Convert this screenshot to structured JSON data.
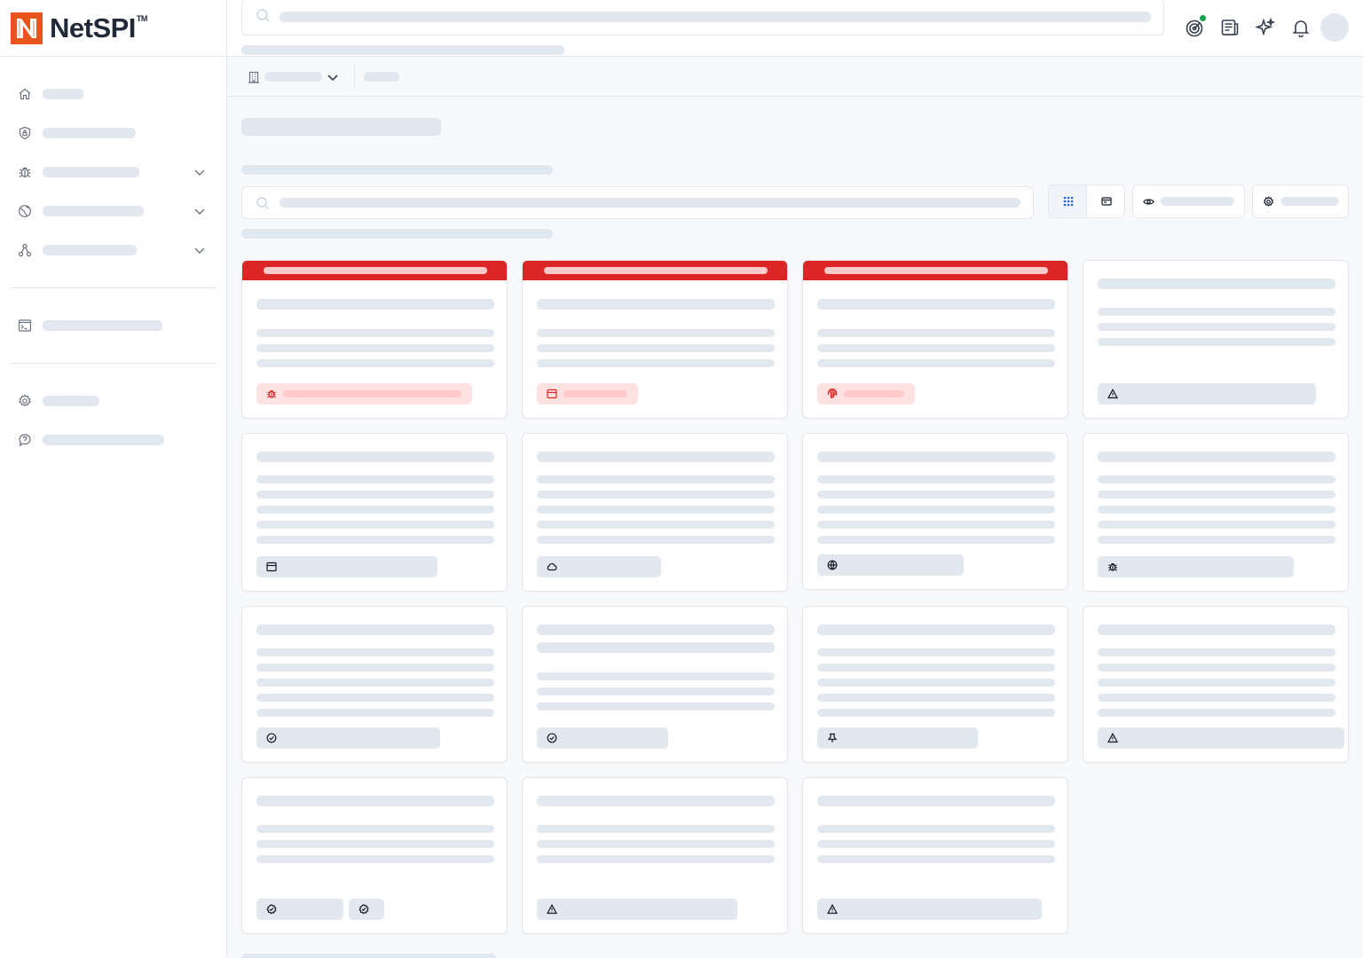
{
  "app": {
    "brand": "NetSPI",
    "trademark": "TM"
  },
  "colors": {
    "accent": "#dc2626",
    "brand_orange": "#e8541b",
    "skeleton": "#e2e8f0",
    "status_dot": "#16a34a",
    "active_view": "#2563eb"
  },
  "sidebar": {
    "items": [
      {
        "icon": "home-icon",
        "expandable": false
      },
      {
        "icon": "shield-icon",
        "expandable": false
      },
      {
        "icon": "bug-icon",
        "expandable": true
      },
      {
        "icon": "globe-icon",
        "expandable": true
      },
      {
        "icon": "network-icon",
        "expandable": true
      },
      {
        "icon": "terminal-icon",
        "expandable": false
      },
      {
        "icon": "gear-icon",
        "expandable": false
      },
      {
        "icon": "support-chat-icon",
        "expandable": false
      }
    ]
  },
  "topbar": {
    "icons": [
      "target-icon",
      "news-icon",
      "sparkle-icon",
      "bell-icon"
    ],
    "target_status": "online"
  },
  "subbar": {
    "icon": "building-icon"
  },
  "toolbar": {
    "view_modes": [
      "grid-view-icon",
      "card-view-icon"
    ],
    "active_view": "grid",
    "buttons": [
      "eye-icon",
      "gear-icon"
    ]
  },
  "cards": [
    {
      "header": true,
      "tag_icon": "bug-icon",
      "tag_style": "critical"
    },
    {
      "header": true,
      "tag_icon": "window-icon",
      "tag_style": "critical"
    },
    {
      "header": true,
      "tag_icon": "fingerprint-icon",
      "tag_style": "critical"
    },
    {
      "header": false,
      "tag_icon": "warning-icon",
      "tag_style": "neutral"
    },
    {
      "header": false,
      "tag_icon": "window-icon",
      "tag_style": "neutral"
    },
    {
      "header": false,
      "tag_icon": "cloud-icon",
      "tag_style": "neutral"
    },
    {
      "header": false,
      "tag_icon": "globe-icon",
      "tag_style": "neutral"
    },
    {
      "header": false,
      "tag_icon": "bug-icon",
      "tag_style": "neutral"
    },
    {
      "header": false,
      "tag_icon": "check-circle-icon",
      "tag_style": "neutral"
    },
    {
      "header": false,
      "tag_icon": "check-circle-icon",
      "tag_style": "neutral"
    },
    {
      "header": false,
      "tag_icon": "push-pin-icon",
      "tag_style": "neutral"
    },
    {
      "header": false,
      "tag_icon": "warning-icon",
      "tag_style": "neutral"
    },
    {
      "header": false,
      "tag_icon": "verified-badge-icon",
      "tag_style": "neutral"
    },
    {
      "header": false,
      "tag_icon": "warning-icon",
      "tag_style": "neutral"
    },
    {
      "header": false,
      "tag_icon": "warning-icon",
      "tag_style": "neutral"
    }
  ]
}
